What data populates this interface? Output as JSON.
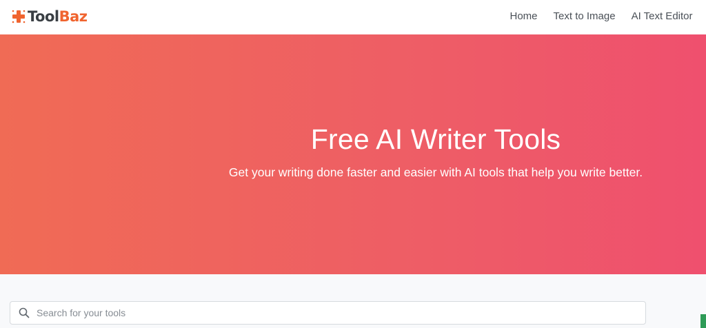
{
  "header": {
    "logo": {
      "part1": "Tool",
      "part2": "Baz"
    },
    "nav": [
      {
        "label": "Home"
      },
      {
        "label": "Text to Image"
      },
      {
        "label": "AI Text Editor"
      }
    ]
  },
  "hero": {
    "title": "Free AI Writer Tools",
    "subtitle": "Get your writing done faster and easier with AI tools that help you write better."
  },
  "search": {
    "placeholder": "Search for your tools",
    "value": "",
    "icon": "search-icon"
  },
  "colors": {
    "brand_orange": "#f0642f",
    "hero_start": "#f06b55",
    "hero_end": "#ef506e",
    "accent_green": "#2e9b57"
  }
}
